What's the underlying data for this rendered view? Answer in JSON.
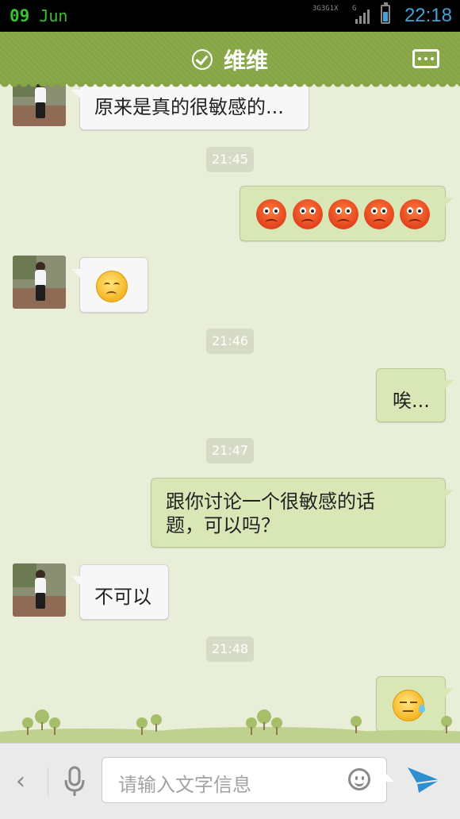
{
  "status_bar": {
    "date_day": "09",
    "date_month": "Jun",
    "network_labels": [
      "3G",
      "3G",
      "1X",
      "G"
    ],
    "time": "22:18",
    "accent_date_color": "#37c22f",
    "accent_time_color": "#3fa4d6"
  },
  "header": {
    "title": "维维",
    "background_color": "#86a545",
    "left_icon": "check-circle-icon",
    "right_icon": "more-options-icon"
  },
  "messages": [
    {
      "side": "in",
      "type": "text",
      "text": "原来是真的很敏感的..."
    },
    {
      "type": "timestamp",
      "text": "21:45"
    },
    {
      "side": "out",
      "type": "emoji",
      "emoji": [
        "angry-face-icon",
        "angry-face-icon",
        "angry-face-icon",
        "angry-face-icon",
        "angry-face-icon"
      ]
    },
    {
      "side": "in",
      "type": "emoji",
      "emoji": [
        "sad-face-icon"
      ]
    },
    {
      "type": "timestamp",
      "text": "21:46"
    },
    {
      "side": "out",
      "type": "text",
      "text": "唉..."
    },
    {
      "type": "timestamp",
      "text": "21:47"
    },
    {
      "side": "out",
      "type": "text",
      "text_line1": "跟你讨论一个很敏感的话",
      "text_line2": "题，可以吗？"
    },
    {
      "side": "in",
      "type": "text",
      "text": "不可以"
    },
    {
      "type": "timestamp",
      "text": "21:48"
    },
    {
      "side": "out",
      "type": "emoji",
      "emoji": [
        "sweat-face-icon"
      ]
    }
  ],
  "input_bar": {
    "placeholder": "请输入文字信息",
    "left_icon": "back-chevron-icon",
    "voice_icon": "microphone-icon",
    "emoji_icon": "smiley-icon",
    "send_icon": "send-icon",
    "back_glyph": "‹"
  }
}
